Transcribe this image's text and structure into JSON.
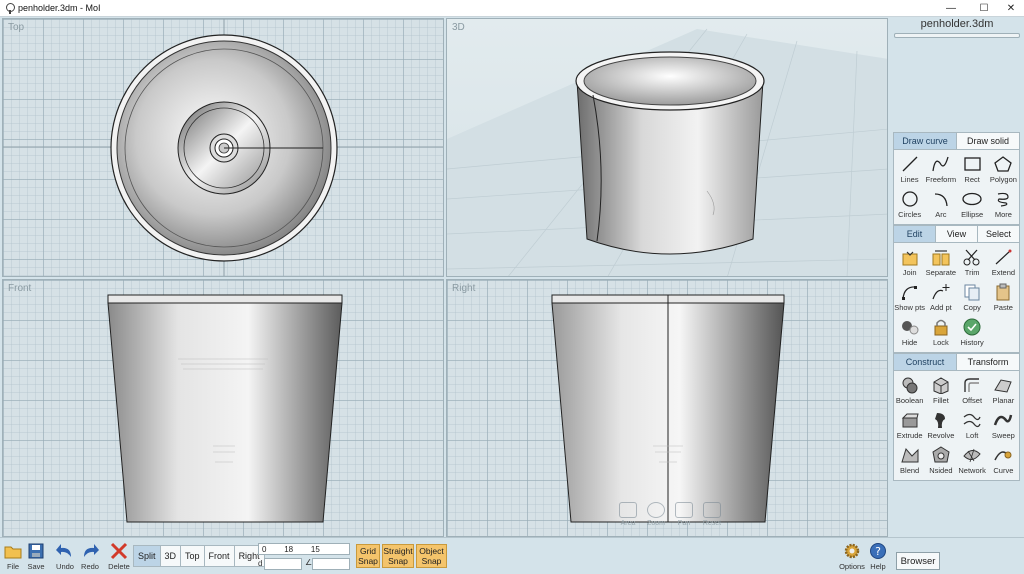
{
  "window": {
    "title": "penholder.3dm - MoI",
    "minimize": "—",
    "maximize": "☐",
    "close": "✕"
  },
  "viewports": {
    "top": "Top",
    "persp": "3D",
    "front": "Front",
    "right": "Right"
  },
  "nav_tools": [
    "Area",
    "Zoom",
    "Pan",
    "Reset"
  ],
  "panel": {
    "file_name": "penholder.3dm",
    "draw": {
      "tabs": [
        "Draw curve",
        "Draw solid"
      ],
      "active": 0,
      "tools": [
        {
          "label": "Lines",
          "icon": "line-icon"
        },
        {
          "label": "Freeform",
          "icon": "freeform-curve-icon"
        },
        {
          "label": "Rect",
          "icon": "rectangle-icon"
        },
        {
          "label": "Polygon",
          "icon": "polygon-icon"
        },
        {
          "label": "Circles",
          "icon": "circle-icon"
        },
        {
          "label": "Arc",
          "icon": "arc-icon"
        },
        {
          "label": "Ellipse",
          "icon": "ellipse-icon"
        },
        {
          "label": "More",
          "icon": "spiral-icon"
        }
      ]
    },
    "edit": {
      "tabs": [
        "Edit",
        "View",
        "Select"
      ],
      "active": 0,
      "tools": [
        {
          "label": "Join",
          "icon": "join-icon"
        },
        {
          "label": "Separate",
          "icon": "separate-icon"
        },
        {
          "label": "Trim",
          "icon": "scissors-icon"
        },
        {
          "label": "Extend",
          "icon": "extend-icon"
        },
        {
          "label": "Show pts",
          "icon": "show-points-icon"
        },
        {
          "label": "Add pt",
          "icon": "add-point-icon"
        },
        {
          "label": "Copy",
          "icon": "copy-icon"
        },
        {
          "label": "Paste",
          "icon": "paste-icon"
        },
        {
          "label": "Hide",
          "icon": "hide-icon"
        },
        {
          "label": "Lock",
          "icon": "lock-icon"
        },
        {
          "label": "History",
          "icon": "history-icon"
        }
      ]
    },
    "construct": {
      "tabs": [
        "Construct",
        "Transform"
      ],
      "active": 0,
      "tools": [
        {
          "label": "Boolean",
          "icon": "boolean-icon"
        },
        {
          "label": "Fillet",
          "icon": "fillet-icon"
        },
        {
          "label": "Offset",
          "icon": "offset-icon"
        },
        {
          "label": "Planar",
          "icon": "planar-icon"
        },
        {
          "label": "Extrude",
          "icon": "extrude-icon"
        },
        {
          "label": "Revolve",
          "icon": "revolve-icon"
        },
        {
          "label": "Loft",
          "icon": "loft-icon"
        },
        {
          "label": "Sweep",
          "icon": "sweep-icon"
        },
        {
          "label": "Blend",
          "icon": "blend-icon"
        },
        {
          "label": "Nsided",
          "icon": "nsided-icon"
        },
        {
          "label": "Network",
          "icon": "network-icon"
        },
        {
          "label": "Curve",
          "icon": "curve-tools-icon"
        }
      ]
    }
  },
  "bottom": {
    "file": "File",
    "save": "Save",
    "undo": "Undo",
    "redo": "Redo",
    "delete": "Delete",
    "views": [
      "Split",
      "3D",
      "Top",
      "Front",
      "Right"
    ],
    "active_view": 0,
    "coords": {
      "x": "0",
      "y": "18",
      "z": "15",
      "d_label": "d",
      "d": "",
      "angle_label": "∠",
      "angle": ""
    },
    "snaps": [
      {
        "line1": "Grid",
        "line2": "Snap"
      },
      {
        "line1": "Straight",
        "line2": "Snap"
      },
      {
        "line1": "Object",
        "line2": "Snap"
      }
    ],
    "options": "Options",
    "help": "Help",
    "browser": "Browser"
  },
  "colors": {
    "accent_tab": "#bcd4e6",
    "snap_on": "#f4c46b",
    "viewport_bg": "#d6e1e6"
  }
}
